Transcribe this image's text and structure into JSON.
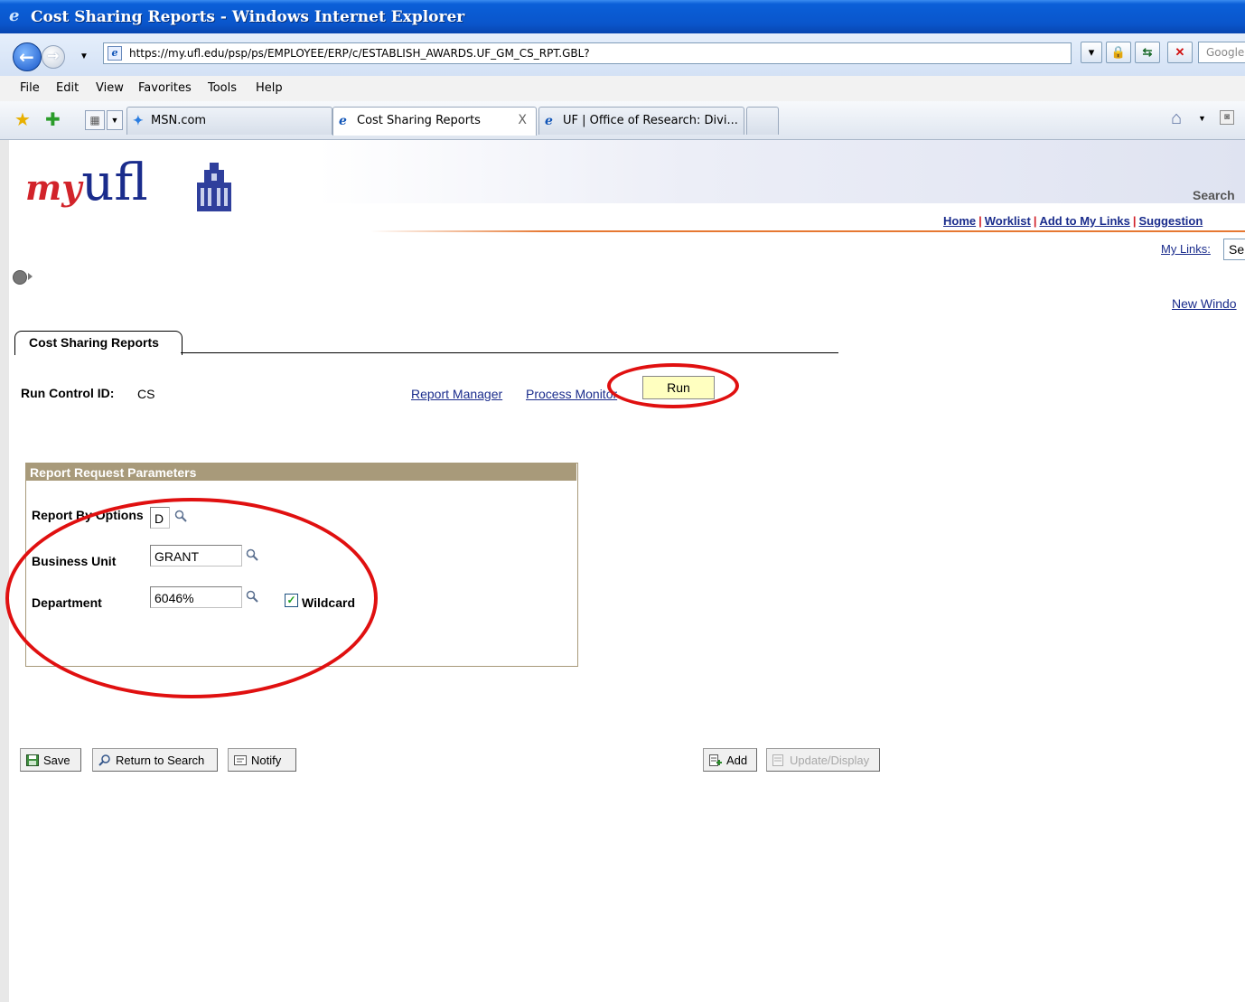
{
  "window": {
    "title": "Cost Sharing Reports - Windows Internet Explorer"
  },
  "addressbar": {
    "url": "https://my.ufl.edu/psp/ps/EMPLOYEE/ERP/c/ESTABLISH_AWARDS.UF_GM_CS_RPT.GBL?",
    "search_placeholder": "Google"
  },
  "menu": {
    "items": [
      "File",
      "Edit",
      "View",
      "Favorites",
      "Tools",
      "Help"
    ]
  },
  "tabs": [
    {
      "label": "MSN.com",
      "icon": "msn-butterfly-icon"
    },
    {
      "label": "Cost Sharing Reports",
      "icon": "ie-icon",
      "close": "X"
    },
    {
      "label": "UF | Office of Research: Divi...",
      "icon": "ie-icon"
    }
  ],
  "portal": {
    "logo_my": "my",
    "logo_ufl": "ufl",
    "search_label": "Search",
    "links": [
      "Home",
      "Worklist",
      "Add to My Links",
      "Suggestion"
    ],
    "mylinks_label": "My Links:",
    "mylinks_value": "Se",
    "new_window": "New Windo"
  },
  "page": {
    "tab_label": "Cost Sharing Reports",
    "run_control_label": "Run Control ID:",
    "run_control_value": "CS",
    "report_manager": "Report Manager",
    "process_monitor": "Process Monitor",
    "run_label": "Run"
  },
  "params": {
    "header": "Report Request Parameters",
    "report_by_label": "Report By Options",
    "report_by_value": "D",
    "business_unit_label": "Business Unit",
    "business_unit_value": "GRANT",
    "department_label": "Department",
    "department_value": "6046%",
    "wildcard_label": "Wildcard",
    "wildcard_checked": true
  },
  "toolbar": {
    "save": "Save",
    "return_to_search": "Return to Search",
    "notify": "Notify",
    "add": "Add",
    "update_display": "Update/Display"
  },
  "colors": {
    "annotation_red": "#e01010",
    "brand_red": "#d2232a",
    "brand_blue": "#1a2c8c",
    "run_button_bg": "#ffffc0",
    "group_header": "#a89a7a"
  }
}
